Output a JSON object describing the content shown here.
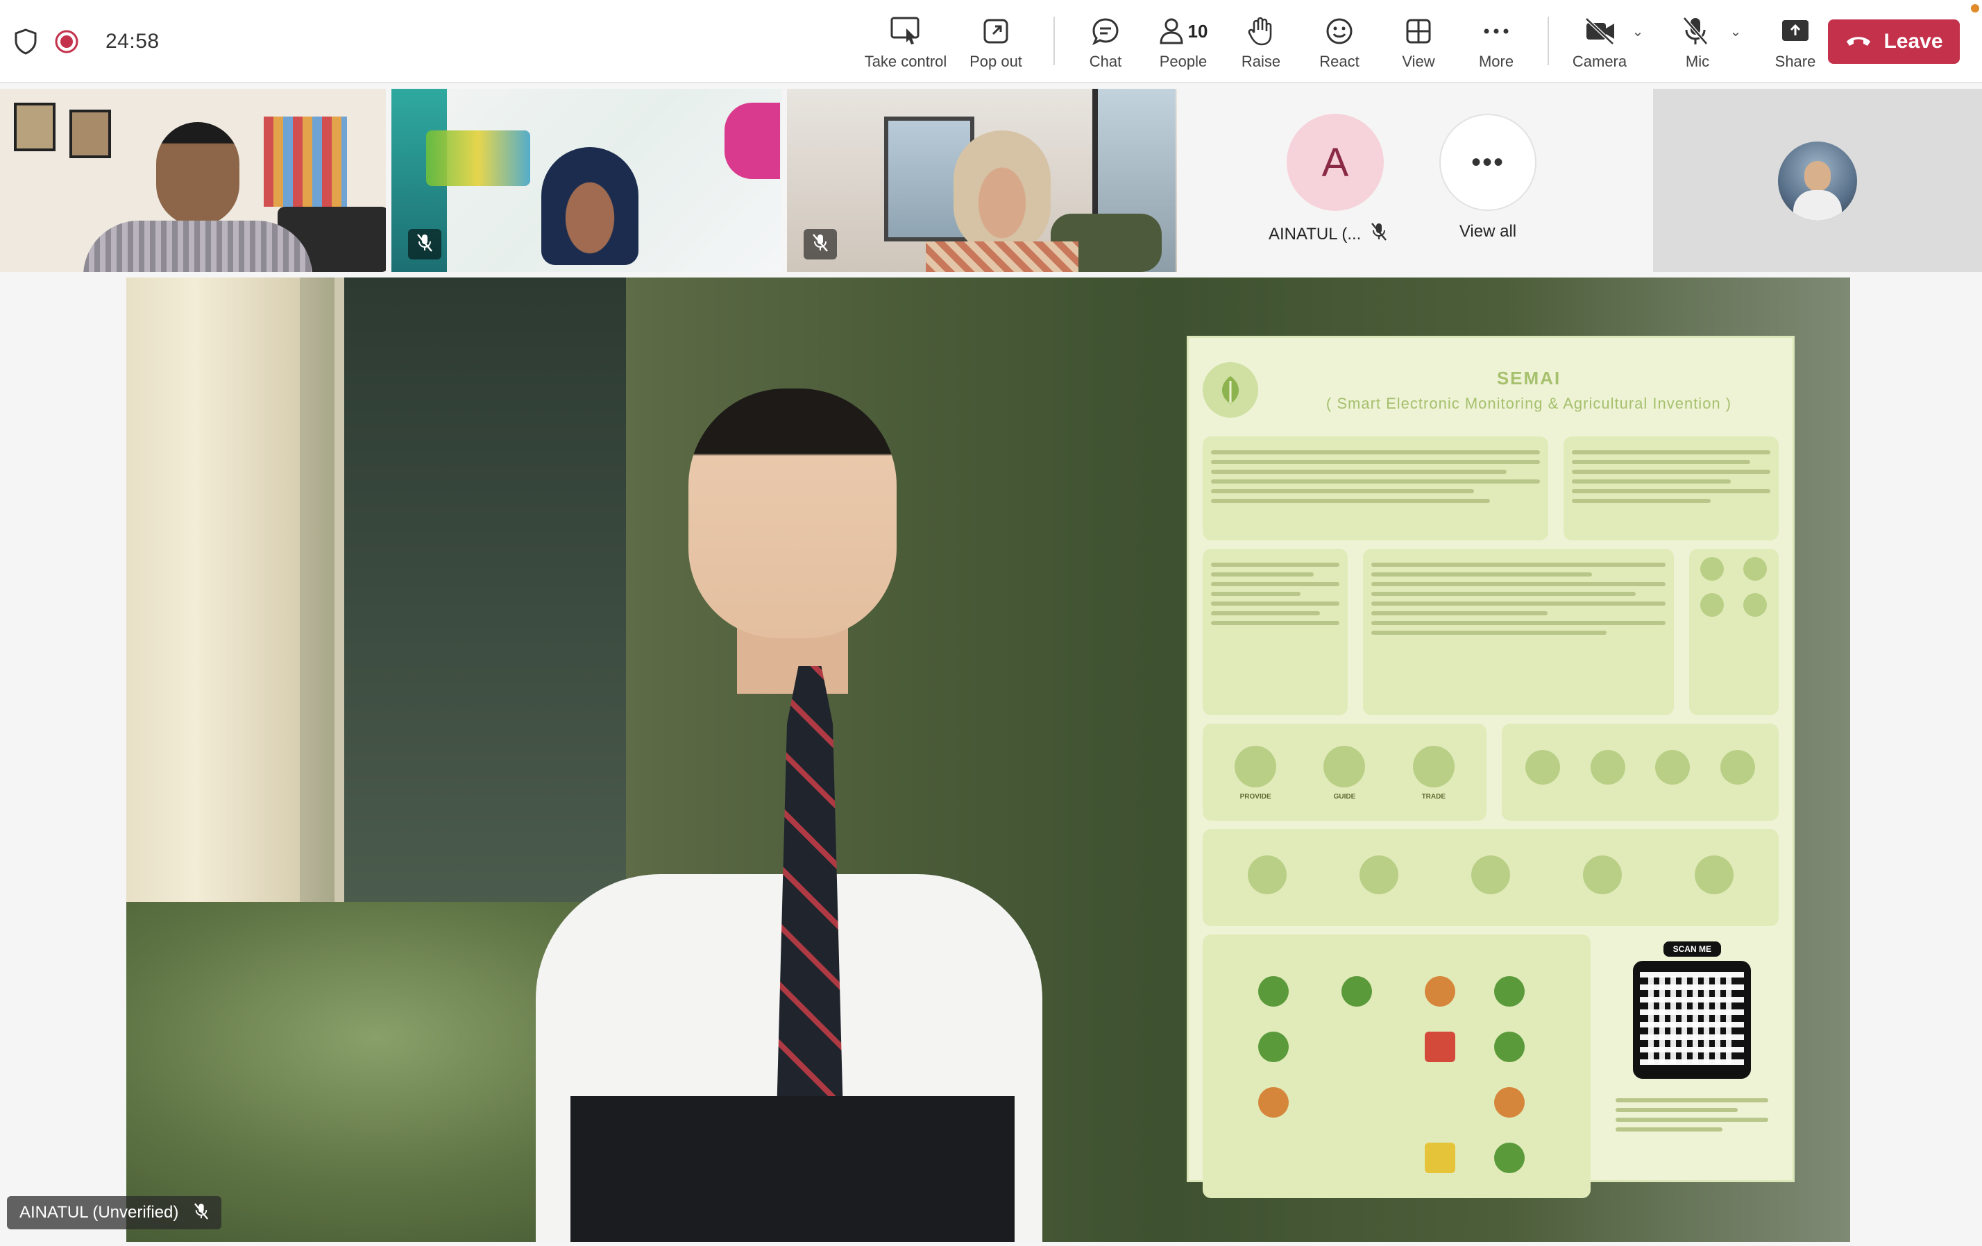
{
  "meeting": {
    "timer": "24:58",
    "recording": true
  },
  "toolbar": {
    "take_control": "Take control",
    "pop_out": "Pop out",
    "chat": "Chat",
    "people": "People",
    "people_count": "10",
    "raise": "Raise",
    "react": "React",
    "view": "View",
    "more": "More",
    "camera": "Camera",
    "mic": "Mic",
    "share": "Share",
    "leave": "Leave"
  },
  "participants": {
    "tile_a_initial": "A",
    "tile_a_name": "AINATUL (...",
    "view_all": "View all",
    "speaker_name": "AINATUL (Unverified)"
  },
  "poster": {
    "title": "SEMAI",
    "subtitle": "( Smart Electronic Monitoring & Agricultural Invention )",
    "key_activity_items": [
      "PROVIDE",
      "GUIDE",
      "TRADE"
    ],
    "scan_label": "SCAN ME"
  },
  "colors": {
    "leave": "#c4314b",
    "avatar_a_bg": "#f6d3da",
    "recording": "#c4314b"
  }
}
